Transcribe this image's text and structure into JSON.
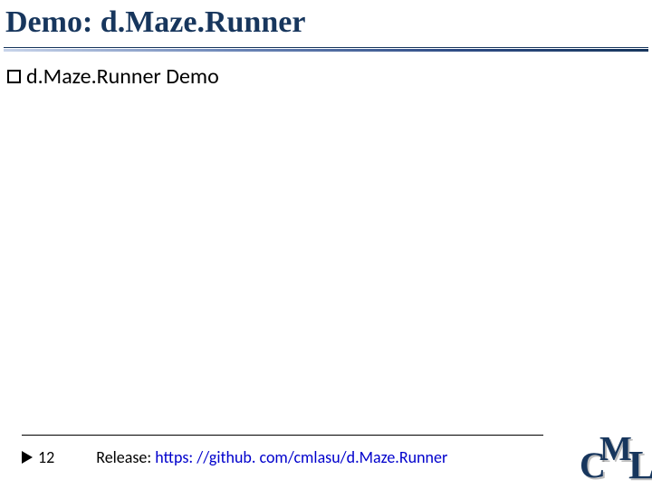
{
  "title": "Demo: d.Maze.Runner",
  "bullet": {
    "text": "d.Maze.Runner Demo"
  },
  "footer": {
    "page_number": "12",
    "release_label": "Release: ",
    "release_url": "https: //github. com/cmlasu/d.Maze.Runner"
  },
  "logo": {
    "c": "C",
    "m": "M",
    "l": "L"
  }
}
